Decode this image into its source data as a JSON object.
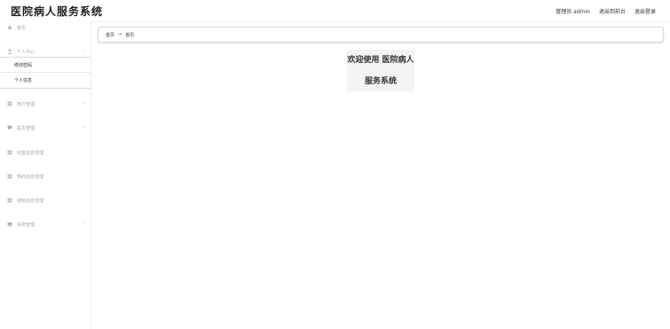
{
  "header": {
    "title": "医院病人服务系统",
    "user_label": "管理员 admin",
    "front_link": "退出到前台",
    "logout_link": "退出登录"
  },
  "sidebar": {
    "items": [
      {
        "label": "首页",
        "icon": "home-icon"
      },
      {
        "label": "个人中心",
        "icon": "user-icon"
      },
      {
        "label": "用户管理",
        "icon": "grid-icon"
      },
      {
        "label": "医生管理",
        "icon": "chat-icon"
      },
      {
        "label": "科室信息管理",
        "icon": "grid-icon"
      },
      {
        "label": "预约信息管理",
        "icon": "grid-icon"
      },
      {
        "label": "通知信息管理",
        "icon": "grid-icon"
      },
      {
        "label": "系统管理",
        "icon": "monitor-icon"
      }
    ],
    "submenu": [
      {
        "label": "修改密码"
      },
      {
        "label": "个人信息"
      }
    ]
  },
  "breadcrumb": {
    "first": "首页",
    "separator": "→",
    "second": "首页"
  },
  "welcome": {
    "line1": "欢迎使用 医院病人",
    "line2": "服务系统"
  }
}
